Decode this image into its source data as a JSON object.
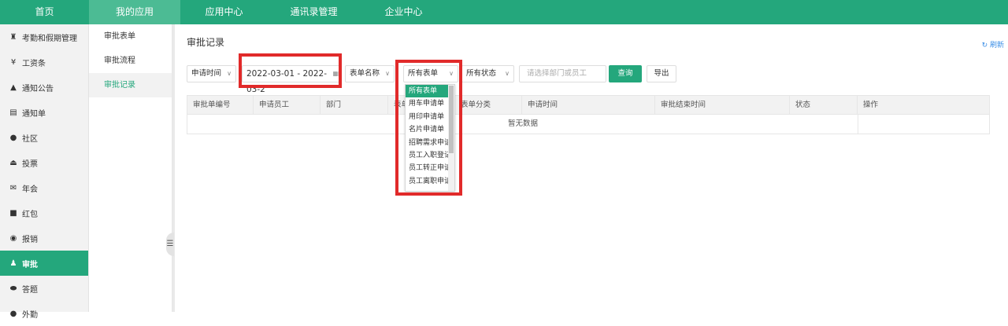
{
  "topnav": {
    "tabs": [
      {
        "label": "首页",
        "active": false
      },
      {
        "label": "我的应用",
        "active": true
      },
      {
        "label": "应用中心",
        "active": false
      },
      {
        "label": "通讯录管理",
        "active": false
      },
      {
        "label": "企业中心",
        "active": false
      }
    ]
  },
  "sidebar": {
    "items": [
      {
        "label": "考勤和假期管理",
        "icon": "person-clock-icon",
        "active": false
      },
      {
        "label": "工资条",
        "icon": "yen-icon",
        "active": false
      },
      {
        "label": "通知公告",
        "icon": "bell-icon",
        "active": false
      },
      {
        "label": "通知单",
        "icon": "list-icon",
        "active": false
      },
      {
        "label": "社区",
        "icon": "chat-icon",
        "active": false
      },
      {
        "label": "投票",
        "icon": "vote-icon",
        "active": false
      },
      {
        "label": "年会",
        "icon": "mail-icon",
        "active": false
      },
      {
        "label": "红包",
        "icon": "red-packet-icon",
        "active": false
      },
      {
        "label": "报销",
        "icon": "coin-icon",
        "active": false
      },
      {
        "label": "审批",
        "icon": "user-check-icon",
        "active": true
      },
      {
        "label": "答题",
        "icon": "pill-icon",
        "active": false
      },
      {
        "label": "外勤",
        "icon": "location-icon",
        "active": false
      }
    ]
  },
  "subnav": {
    "items": [
      {
        "label": "审批表单",
        "active": false
      },
      {
        "label": "审批流程",
        "active": false
      },
      {
        "label": "审批记录",
        "active": true
      }
    ]
  },
  "page": {
    "title": "审批记录",
    "refresh_label": "刷新"
  },
  "filters": {
    "time_type": "申请时间",
    "date_range": "2022-03-01 - 2022-03-2",
    "form_field": "表单名称",
    "form_select": "所有表单",
    "status_select": "所有状态",
    "search_placeholder": "请选择部门或员工",
    "query_label": "查询",
    "export_label": "导出"
  },
  "table": {
    "columns": [
      "审批单编号",
      "申请员工",
      "部门",
      "表单名称",
      "表单分类",
      "申请时间",
      "审批结束时间",
      "状态",
      "操作"
    ],
    "empty_text": "暂无数据"
  },
  "dropdown": {
    "options": [
      "所有表单",
      "用车申请单",
      "用印申请单",
      "名片申请单",
      "招聘需求申请",
      "员工入职登记",
      "员工转正申请",
      "员工离职申请"
    ],
    "selected": 0
  },
  "colors": {
    "accent": "#24a77c",
    "highlight": "#e12a2a"
  }
}
